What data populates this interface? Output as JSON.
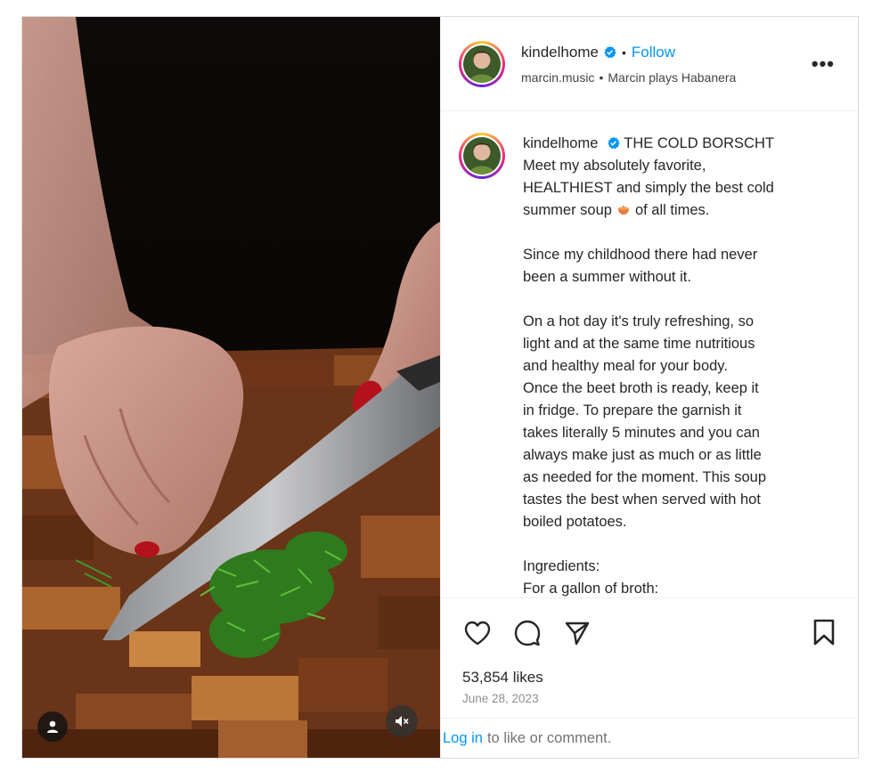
{
  "post": {
    "username": "kindelhome",
    "verified": true,
    "follow_label": "Follow",
    "audio_artist": "marcin.music",
    "audio_track": "Marcin plays Habanera",
    "more_label": "•••"
  },
  "caption": {
    "username": "kindelhome",
    "title": "THE COLD BORSCHT",
    "line_intro_a": "Meet my absolutely favorite,",
    "line_intro_b": "HEALTHIEST and simply the best cold",
    "line_intro_c1": "summer soup",
    "line_intro_c2": "of all times.",
    "para2_a": "Since my childhood there had never",
    "para2_b": "been a summer without it.",
    "para3_a": "On a hot day it's truly refreshing, so",
    "para3_b": "light and at the same time nutritious",
    "para3_c": "and healthy meal for your body.",
    "para3_d": "Once the beet broth is ready, keep it",
    "para3_e": "in fridge. To prepare the garnish it",
    "para3_f": "takes literally 5 minutes and you can",
    "para3_g": "always make just as much or as little",
    "para3_h": "as needed for the moment. This soup",
    "para3_i": "tastes the best when served with hot",
    "para3_j": "boiled potatoes.",
    "ingredients": "Ingredients:",
    "cut_line": "For a gallon of broth:"
  },
  "stats": {
    "likes": "53,854 likes",
    "date": "June 28, 2023"
  },
  "footer": {
    "login_link": "Log in",
    "login_rest": "to like or comment."
  },
  "icons": {
    "like": "heart-icon",
    "comment": "comment-icon",
    "share": "share-icon",
    "save": "bookmark-icon",
    "user_tag": "user-icon",
    "mute": "speaker-muted-icon"
  },
  "colors": {
    "link_blue": "#0095f6",
    "nail_red": "#b3121b",
    "board_brown": "#7a3d1c"
  }
}
